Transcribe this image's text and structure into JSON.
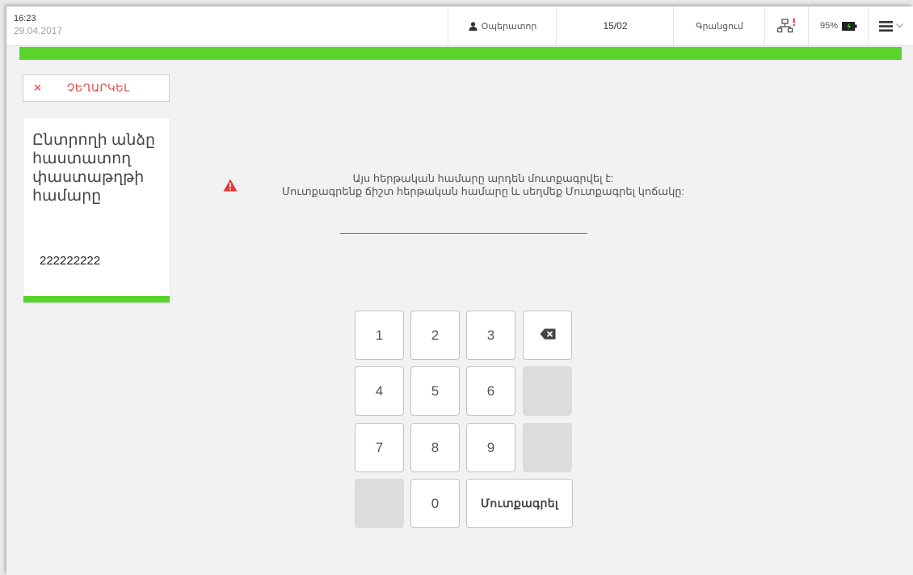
{
  "header": {
    "time": "16:23",
    "date": "29.04.2017",
    "operator_label": "Օպերատոր",
    "counter": "15/02",
    "registration_label": "Գրանցում",
    "network_icon": "network-warning-icon",
    "battery_label": "95%",
    "menu_icon": "hamburger-menu-icon"
  },
  "progress": {
    "fraction": 1.0,
    "color": "#5ad42a"
  },
  "cancel": {
    "icon": "close-icon",
    "label": "ՉԵՂԱՐԿԵԼ"
  },
  "card": {
    "title": "Ընտրողի անձը հաստատող փաստաթղթի համարը",
    "value": "222222222"
  },
  "warning": {
    "icon": "warning-triangle-icon",
    "line1": "Այս հերթական համարը արդեն մուտքագրվել է:",
    "line2": "Մուտքագրենք ճիշտ հերթական համարը և սեղմեք Մուտքագրել կոճակը:"
  },
  "input": {
    "value": ""
  },
  "keypad": {
    "k1": "1",
    "k2": "2",
    "k3": "3",
    "k4": "4",
    "k5": "5",
    "k6": "6",
    "k7": "7",
    "k8": "8",
    "k9": "9",
    "k0": "0",
    "backspace_icon": "backspace-icon",
    "submit": "Մուտքագրել"
  },
  "colors": {
    "accent_green": "#5ad42a",
    "cancel_red": "#e04343",
    "warning_red": "#e53935",
    "input_underline": "#2a8c8c"
  }
}
